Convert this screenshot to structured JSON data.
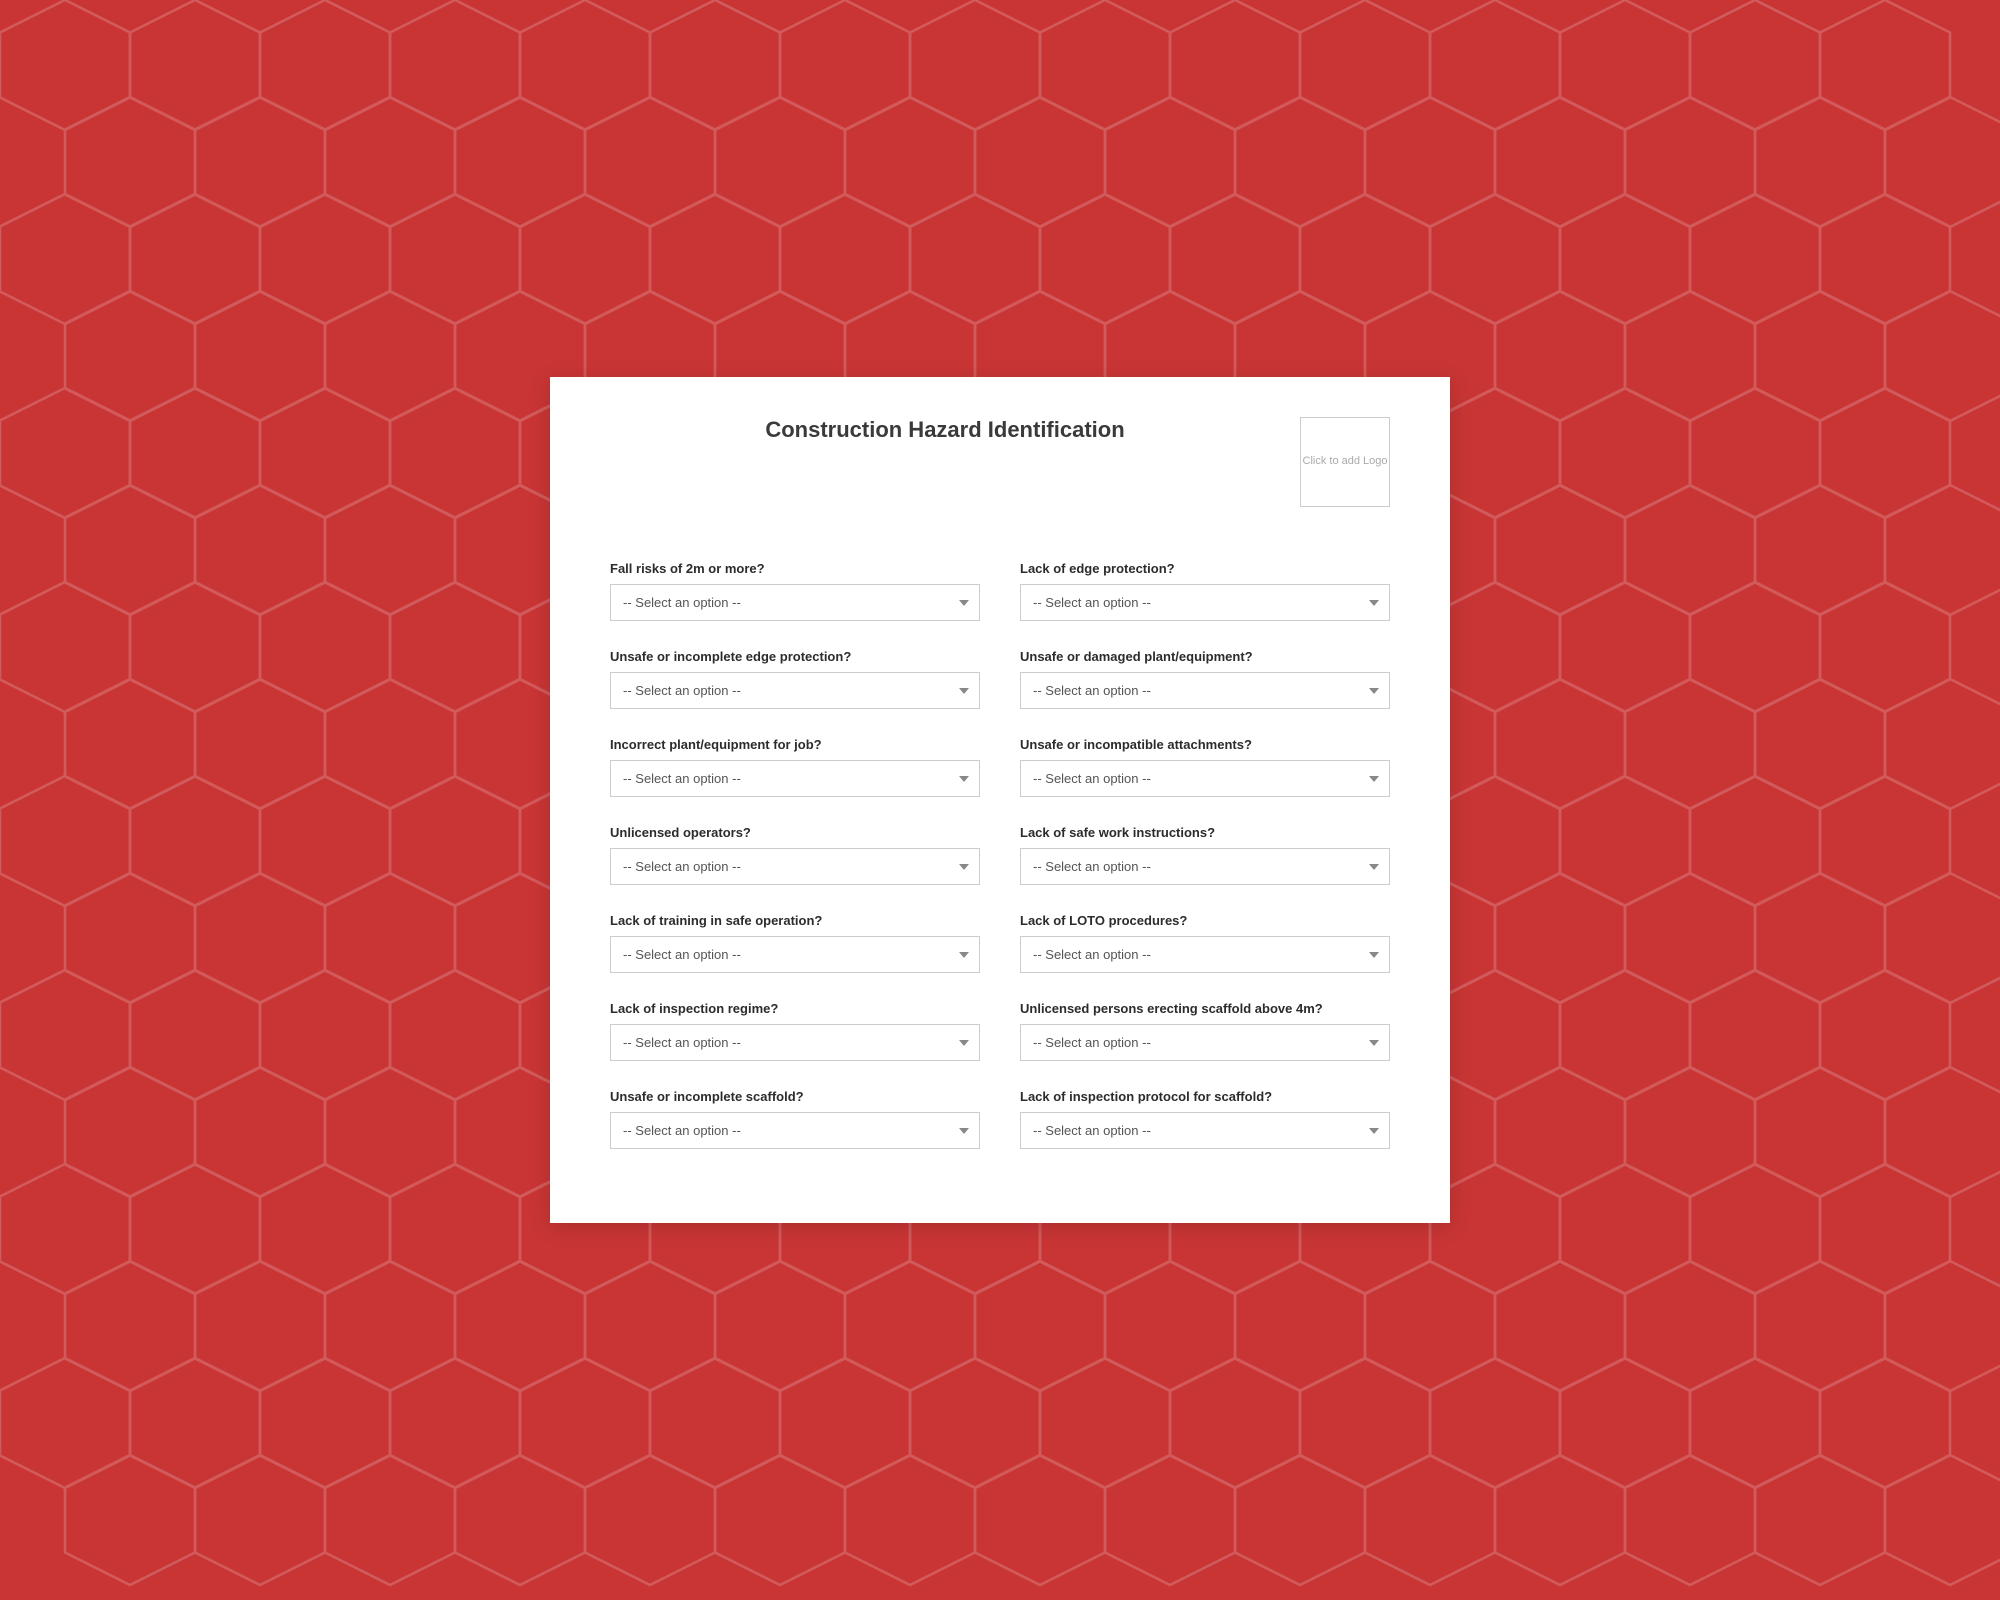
{
  "background": {
    "color": "#c93535"
  },
  "form": {
    "title": "Construction Hazard Identification",
    "logo": {
      "label": "Click to add Logo"
    },
    "select_placeholder": "-- Select an option --",
    "fields": [
      {
        "id": "fall-risks",
        "label": "Fall risks of 2m or more?",
        "col": "left"
      },
      {
        "id": "lack-edge-protection",
        "label": "Lack of edge protection?",
        "col": "right"
      },
      {
        "id": "unsafe-edge-protection",
        "label": "Unsafe or incomplete edge protection?",
        "col": "left"
      },
      {
        "id": "unsafe-damaged-plant",
        "label": "Unsafe or damaged plant/equipment?",
        "col": "right"
      },
      {
        "id": "incorrect-plant",
        "label": "Incorrect plant/equipment for job?",
        "col": "left"
      },
      {
        "id": "unsafe-attachments",
        "label": "Unsafe or incompatible attachments?",
        "col": "right"
      },
      {
        "id": "unlicensed-operators",
        "label": "Unlicensed operators?",
        "col": "left"
      },
      {
        "id": "lack-safe-work",
        "label": "Lack of safe work instructions?",
        "col": "right"
      },
      {
        "id": "lack-training",
        "label": "Lack of training in safe operation?",
        "col": "left"
      },
      {
        "id": "lack-loto",
        "label": "Lack of LOTO procedures?",
        "col": "right"
      },
      {
        "id": "lack-inspection-regime",
        "label": "Lack of inspection regime?",
        "col": "left"
      },
      {
        "id": "unlicensed-scaffold",
        "label": "Unlicensed persons erecting scaffold above 4m?",
        "col": "right"
      },
      {
        "id": "unsafe-scaffold",
        "label": "Unsafe or incomplete scaffold?",
        "col": "left"
      },
      {
        "id": "lack-inspection-protocol",
        "label": "Lack of inspection protocol for scaffold?",
        "col": "right"
      }
    ]
  }
}
